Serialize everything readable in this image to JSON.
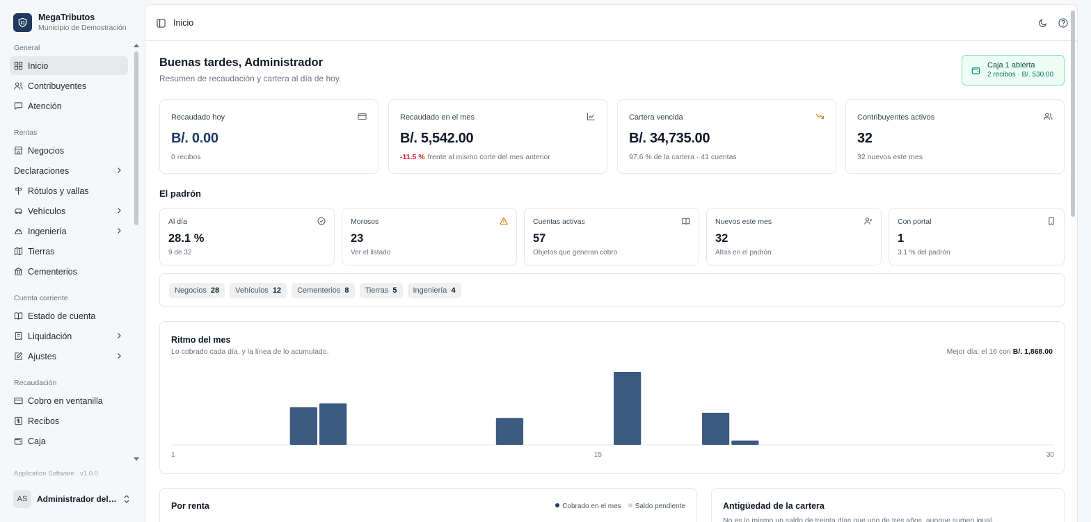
{
  "brand": {
    "name": "MegaTributos",
    "subtitle": "Municipio de Demostración"
  },
  "sidebar": {
    "groups": [
      {
        "label": "General",
        "items": [
          {
            "label": "Inicio",
            "icon": "grid-icon",
            "active": true
          },
          {
            "label": "Contribuyentes",
            "icon": "users-icon"
          },
          {
            "label": "Atención",
            "icon": "message-icon"
          }
        ]
      },
      {
        "label": "Rentas",
        "items": [
          {
            "label": "Negocios",
            "icon": "store-icon"
          },
          {
            "label": "Declaraciones",
            "icon": "",
            "chevron": true
          },
          {
            "label": "Rótulos y vallas",
            "icon": "signpost-icon"
          },
          {
            "label": "Vehículos",
            "icon": "car-icon",
            "chevron": true
          },
          {
            "label": "Ingeniería",
            "icon": "hardhat-icon",
            "chevron": true
          },
          {
            "label": "Tierras",
            "icon": "map-icon"
          },
          {
            "label": "Cementerios",
            "icon": "landmark-icon"
          }
        ]
      },
      {
        "label": "Cuenta corriente",
        "items": [
          {
            "label": "Estado de cuenta",
            "icon": "book-icon"
          },
          {
            "label": "Liquidación",
            "icon": "receipt-icon",
            "chevron": true
          },
          {
            "label": "Ajustes",
            "icon": "edit-icon",
            "chevron": true
          }
        ]
      },
      {
        "label": "Recaudación",
        "items": [
          {
            "label": "Cobro en ventanilla",
            "icon": "credit-card-icon"
          },
          {
            "label": "Recibos",
            "icon": "dollar-receipt-icon"
          },
          {
            "label": "Caja",
            "icon": "wallet-icon"
          }
        ]
      }
    ],
    "version": "Application Software · v1.0.0",
    "user": {
      "initials": "AS",
      "name": "Administrador del sistema"
    }
  },
  "topbar": {
    "breadcrumb": "Inicio"
  },
  "header": {
    "greeting": "Buenas tardes, Administrador",
    "subtitle": "Resumen de recaudación y cartera al día de hoy.",
    "caja": {
      "title": "Caja 1 abierta",
      "detail": "2 recibos · B/. 530.00"
    }
  },
  "kpis": [
    {
      "label": "Recaudado hoy",
      "value": "B/. 0.00",
      "sub": "0 recibos",
      "icon": "card-icon",
      "blue": true
    },
    {
      "label": "Recaudado en el mes",
      "value": "B/. 5,542.00",
      "delta": "-11.5 %",
      "sub": "frente al mismo corte del mes anterior",
      "icon": "chart-line-icon"
    },
    {
      "label": "Cartera vencida",
      "value": "B/. 34,735.00",
      "sub": "97.6 % de la cartera · 41 cuentas",
      "icon": "trending-down-icon"
    },
    {
      "label": "Contribuyentes activos",
      "value": "32",
      "sub": "32 nuevos este mes",
      "icon": "users-icon"
    }
  ],
  "padron": {
    "title": "El padrón",
    "cards": [
      {
        "label": "Al día",
        "value": "28.1 %",
        "sub": "9 de 32",
        "icon": "check-circle-icon"
      },
      {
        "label": "Morosos",
        "value": "23",
        "sub": "Ver el listado",
        "icon": "warning-icon"
      },
      {
        "label": "Cuentas activas",
        "value": "57",
        "sub": "Objetos que generan cobro",
        "icon": "open-book-icon"
      },
      {
        "label": "Nuevos este mes",
        "value": "32",
        "sub": "Altas en el padrón",
        "icon": "user-plus-icon"
      },
      {
        "label": "Con portal",
        "value": "1",
        "sub": "3.1 % del padrón",
        "icon": "phone-icon"
      }
    ],
    "chips": [
      {
        "label": "Negocios",
        "count": "28"
      },
      {
        "label": "Vehículos",
        "count": "12"
      },
      {
        "label": "Cementerios",
        "count": "8"
      },
      {
        "label": "Tierras",
        "count": "5"
      },
      {
        "label": "Ingeniería",
        "count": "4"
      }
    ]
  },
  "rhythm": {
    "title": "Ritmo del mes",
    "description": "Lo cobrado cada día, y la línea de lo acumulado.",
    "best_prefix": "Mejor día: el 16 con",
    "best_value": "B/. 1,868.00"
  },
  "chart_data": {
    "type": "bar",
    "x": [
      1,
      2,
      3,
      4,
      5,
      6,
      7,
      8,
      9,
      10,
      11,
      12,
      13,
      14,
      15,
      16,
      17,
      18,
      19,
      20,
      21,
      22,
      23,
      24,
      25,
      26,
      27,
      28,
      29,
      30
    ],
    "values": [
      0,
      0,
      0,
      0,
      960,
      1060,
      0,
      0,
      0,
      0,
      0,
      690,
      0,
      0,
      0,
      1868,
      0,
      0,
      820,
      110,
      0,
      0,
      0,
      0,
      0,
      0,
      0,
      0,
      0,
      0
    ],
    "tick_labels": [
      "1",
      "15",
      "30"
    ],
    "bar_color": "#3d5a80"
  },
  "renta": {
    "title": "Por renta",
    "legend": [
      {
        "label": "Cobrado en el mes",
        "color": "#1e3a5f"
      },
      {
        "label": "Saldo pendiente",
        "color": "#d1d5db"
      }
    ]
  },
  "antiguedad": {
    "title": "Antigüedad de la cartera",
    "description": "No es lo mismo un saldo de treinta días que uno de tres años, aunque sumen igual."
  }
}
